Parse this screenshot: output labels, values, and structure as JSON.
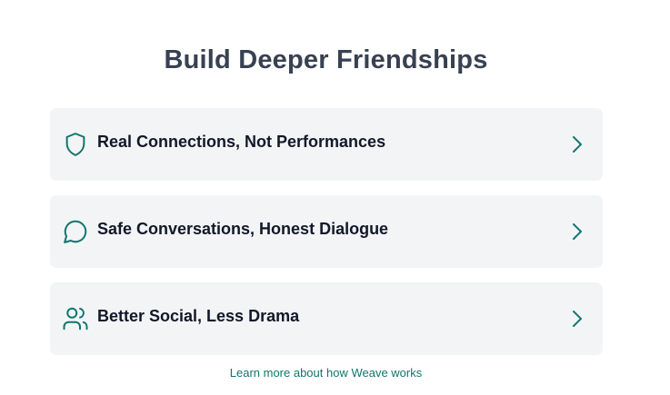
{
  "header": {
    "title": "Build Deeper Friendships"
  },
  "features": [
    {
      "label": "Real Connections, Not Performances",
      "icon": "shield-icon"
    },
    {
      "label": "Safe Conversations, Honest Dialogue",
      "icon": "message-circle-icon"
    },
    {
      "label": "Better Social, Less Drama",
      "icon": "users-icon"
    }
  ],
  "footer": {
    "link_label": "Learn more about how Weave works"
  },
  "colors": {
    "accent": "#0f766e",
    "card_background": "#f3f4f6",
    "title": "#374151",
    "label": "#111827"
  }
}
